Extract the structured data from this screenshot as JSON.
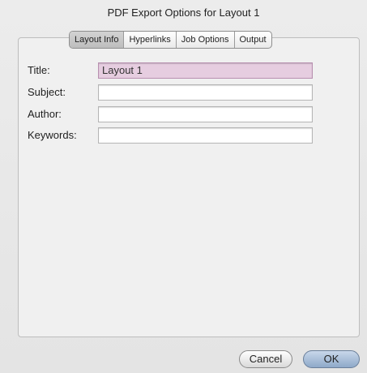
{
  "window": {
    "title": "PDF Export Options for Layout 1"
  },
  "tabs": [
    {
      "label": "Layout Info",
      "active": true
    },
    {
      "label": "Hyperlinks",
      "active": false
    },
    {
      "label": "Job Options",
      "active": false
    },
    {
      "label": "Output",
      "active": false
    }
  ],
  "fields": {
    "title": {
      "label": "Title:",
      "value": "Layout 1"
    },
    "subject": {
      "label": "Subject:",
      "value": ""
    },
    "author": {
      "label": "Author:",
      "value": ""
    },
    "keywords": {
      "label": "Keywords:",
      "value": ""
    }
  },
  "buttons": {
    "cancel": "Cancel",
    "ok": "OK"
  },
  "colors": {
    "focus_field": "#e6cde0",
    "default_button": "#9fb7d4"
  }
}
